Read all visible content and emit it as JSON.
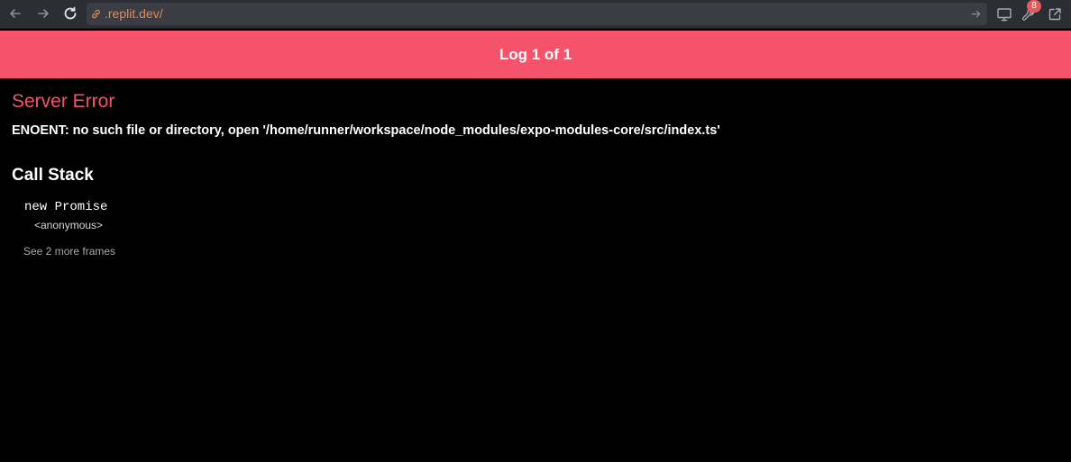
{
  "browser": {
    "url": ".replit.dev/",
    "notification_count": "8",
    "icons": {
      "back": "arrow-left-icon",
      "forward": "arrow-right-icon",
      "reload": "reload-icon",
      "link": "link-icon",
      "go": "arrow-right-icon",
      "screen": "monitor-icon",
      "tools": "wrench-icon",
      "external": "external-link-icon"
    }
  },
  "log": {
    "header": "Log 1 of 1",
    "error_title": "Server Error",
    "error_message": "ENOENT: no such file or directory, open '/home/runner/workspace/node_modules/expo-modules-core/src/index.ts'",
    "call_stack_title": "Call Stack",
    "frames": [
      {
        "name": "new Promise",
        "location": "<anonymous>"
      }
    ],
    "more_frames_label": "See 2 more frames"
  },
  "colors": {
    "accent": "#f5536b",
    "background": "#000000",
    "toolbar": "#2b2e35",
    "url": "#e08a5a"
  }
}
